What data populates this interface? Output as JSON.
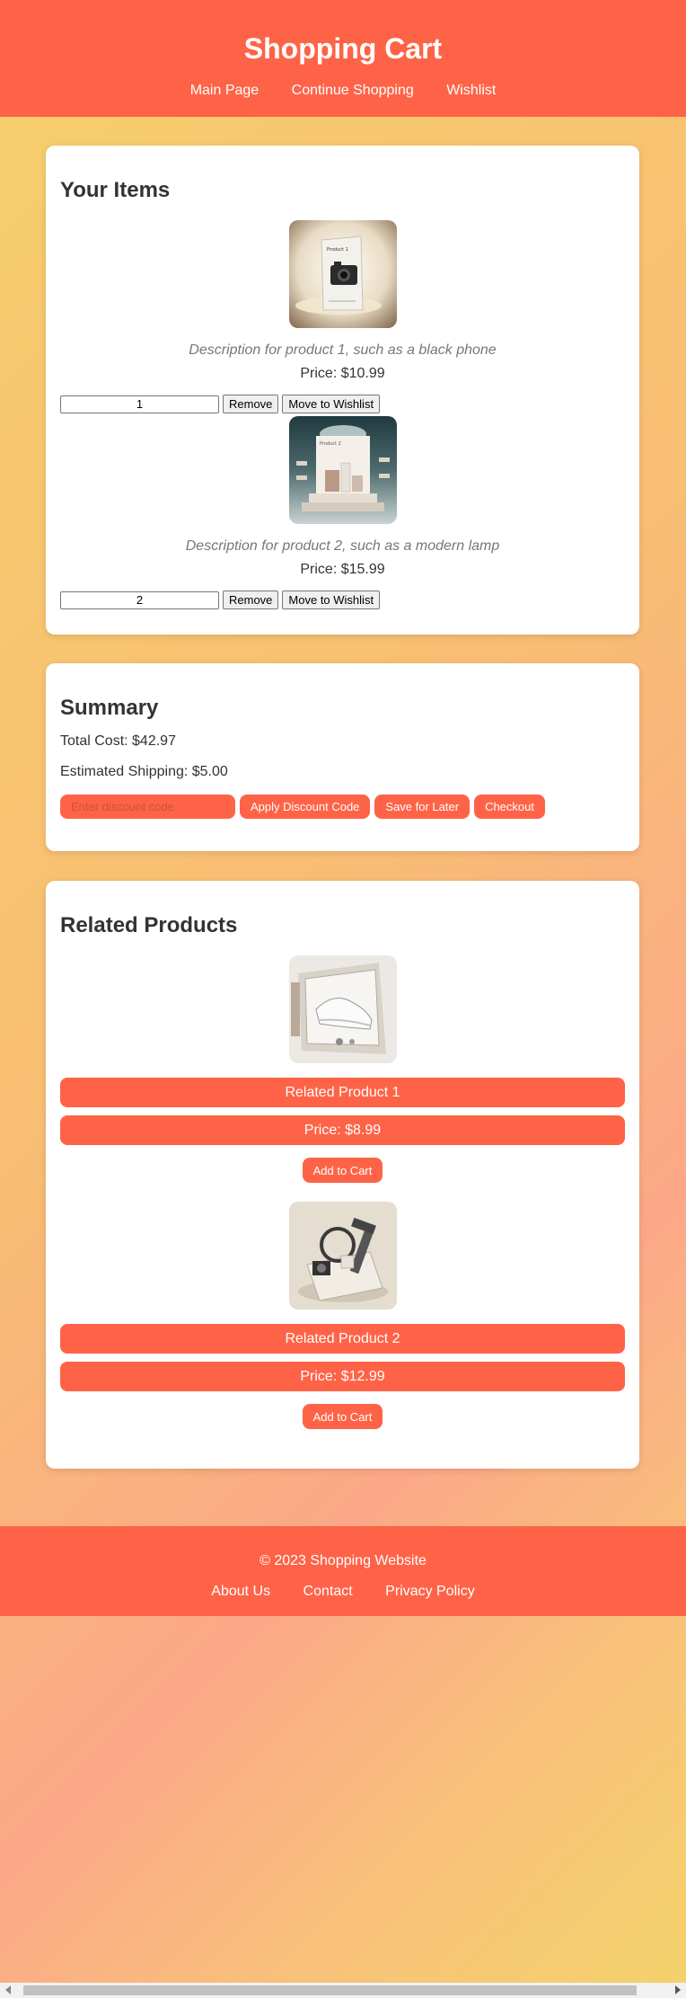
{
  "header": {
    "title": "Shopping Cart",
    "nav": [
      "Main Page",
      "Continue Shopping",
      "Wishlist"
    ]
  },
  "cart": {
    "heading": "Your Items",
    "items": [
      {
        "image_label": "Product 1",
        "description": "Description for product 1, such as a black phone",
        "price": "Price: $10.99",
        "quantity": "1",
        "remove_label": "Remove",
        "wishlist_label": "Move to Wishlist"
      },
      {
        "image_label": "Product 2",
        "description": "Description for product 2, such as a modern lamp",
        "price": "Price: $15.99",
        "quantity": "2",
        "remove_label": "Remove",
        "wishlist_label": "Move to Wishlist"
      }
    ]
  },
  "summary": {
    "heading": "Summary",
    "total": "Total Cost: $42.97",
    "shipping": "Estimated Shipping: $5.00",
    "discount_placeholder": "Enter discount code",
    "apply_label": "Apply Discount Code",
    "save_label": "Save for Later",
    "checkout_label": "Checkout"
  },
  "related": {
    "heading": "Related Products",
    "items": [
      {
        "name": "Related Product 1",
        "price": "Price: $8.99",
        "button": "Add to Cart"
      },
      {
        "name": "Related Product 2",
        "price": "Price: $12.99",
        "button": "Add to Cart"
      }
    ]
  },
  "footer": {
    "copyright": "© 2023 Shopping Website",
    "links": [
      "About Us",
      "Contact",
      "Privacy Policy"
    ]
  },
  "colors": {
    "accent": "#ff6347"
  }
}
